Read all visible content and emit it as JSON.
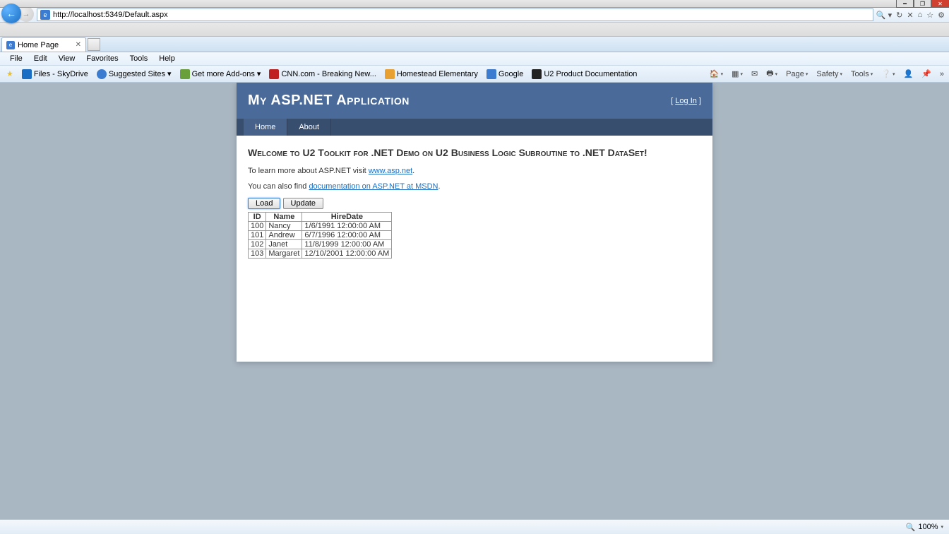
{
  "window": {
    "url": "http://localhost:5349/Default.aspx"
  },
  "tab": {
    "title": "Home Page"
  },
  "menus": [
    "File",
    "Edit",
    "View",
    "Favorites",
    "Tools",
    "Help"
  ],
  "favorites": [
    {
      "label": "Files - SkyDrive",
      "color": "#1a6fc4"
    },
    {
      "label": "Suggested Sites ▾",
      "color": "#3b7cd1"
    },
    {
      "label": "Get more Add-ons ▾",
      "color": "#6aa03a"
    },
    {
      "label": "CNN.com - Breaking New...",
      "color": "#c02020"
    },
    {
      "label": "Homestead Elementary",
      "color": "#e8a030"
    },
    {
      "label": "Google",
      "color": "#3b7cd1"
    },
    {
      "label": "U2 Product Documentation",
      "color": "#222"
    }
  ],
  "toolbar_right": [
    "Page",
    "Safety",
    "Tools"
  ],
  "page": {
    "title": "My ASP.NET Application",
    "login_label": "Log In",
    "nav": {
      "home": "Home",
      "about": "About"
    },
    "heading": "Welcome to U2 Toolkit for .NET Demo on U2 Business Logic Subroutine to .NET DataSet!",
    "learn_prefix": "To learn more about ASP.NET visit ",
    "learn_link": "www.asp.net",
    "doc_prefix": "You can also find ",
    "doc_link": "documentation on ASP.NET at MSDN",
    "buttons": {
      "load": "Load",
      "update": "Update"
    },
    "table": {
      "headers": [
        "ID",
        "Name",
        "HireDate"
      ],
      "rows": [
        {
          "id": "100",
          "name": "Nancy",
          "hire": "1/6/1991 12:00:00 AM"
        },
        {
          "id": "101",
          "name": "Andrew",
          "hire": "6/7/1996 12:00:00 AM"
        },
        {
          "id": "102",
          "name": "Janet",
          "hire": "11/8/1999 12:00:00 AM"
        },
        {
          "id": "103",
          "name": "Margaret",
          "hire": "12/10/2001 12:00:00 AM"
        }
      ]
    }
  },
  "status": {
    "zoom": "100%"
  }
}
